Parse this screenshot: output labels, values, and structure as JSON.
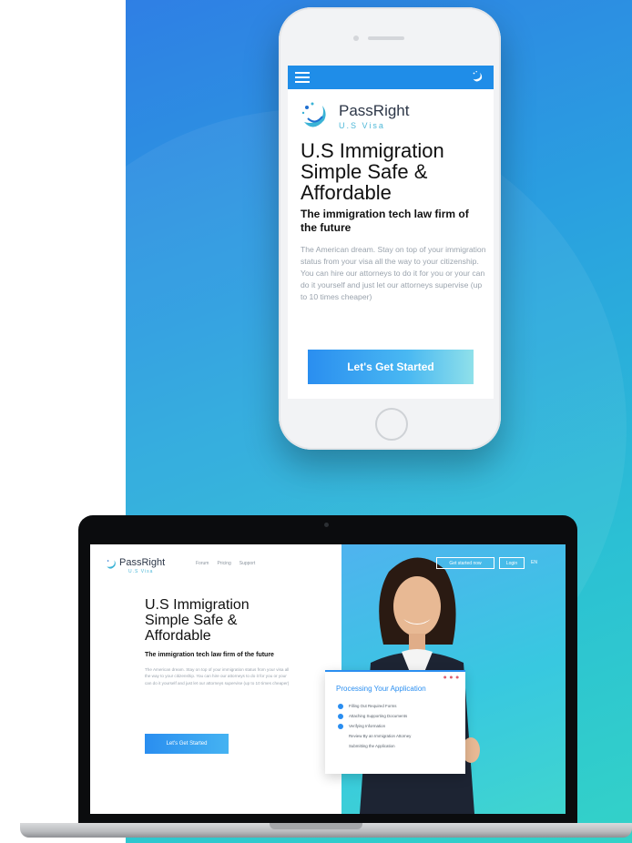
{
  "mobile": {
    "brand": {
      "name": "PassRight",
      "subtitle": "U.S Visa"
    },
    "headline_line1": "U.S Immigration",
    "headline_line2": "Simple Safe &",
    "headline_line3": "Affordable",
    "subhead": "The immigration tech law firm of the future",
    "body": "The American dream. Stay on top of your immigration status from your visa all the way to your citizenship. You can hire our attorneys to do it for you or your can do it yourself and just let our attorneys supervise (up to 10 times cheaper)",
    "cta": "Let's Get Started"
  },
  "desktop": {
    "brand": {
      "name": "PassRight",
      "subtitle": "U.S Visa"
    },
    "nav": [
      "Forum",
      "Pricing",
      "Support"
    ],
    "get_started": "Get started now",
    "login": "Login",
    "lang": "EN",
    "headline_line1": "U.S Immigration",
    "headline_line2": "Simple Safe &",
    "headline_line3": "Affordable",
    "subhead": "The immigration tech law firm of the future",
    "body": "The American dream. Stay on top of your immigration status from your visa all the way to your citizenship. You can hire our attorneys to do it for you or your can do it yourself and just let our attorneys supervise (up to 10 times cheaper)",
    "cta": "Let's Get Started",
    "card": {
      "title": "Processing Your Application",
      "steps": [
        {
          "label": "Filling Out Required Forms",
          "done": true
        },
        {
          "label": "Attaching Supporting Documents",
          "done": true
        },
        {
          "label": "Verifying Information",
          "done": true
        },
        {
          "label": "Review By an Immigration Attorney",
          "done": false
        },
        {
          "label": "Submitting the Application",
          "done": false
        }
      ]
    }
  },
  "colors": {
    "accent": "#2a8ef0",
    "gradient_start": "#2f7fe4",
    "gradient_end": "#33d2c8",
    "brand_teal": "#4fb8d8"
  },
  "icons": [
    "menu-icon",
    "passright-logo-icon"
  ]
}
